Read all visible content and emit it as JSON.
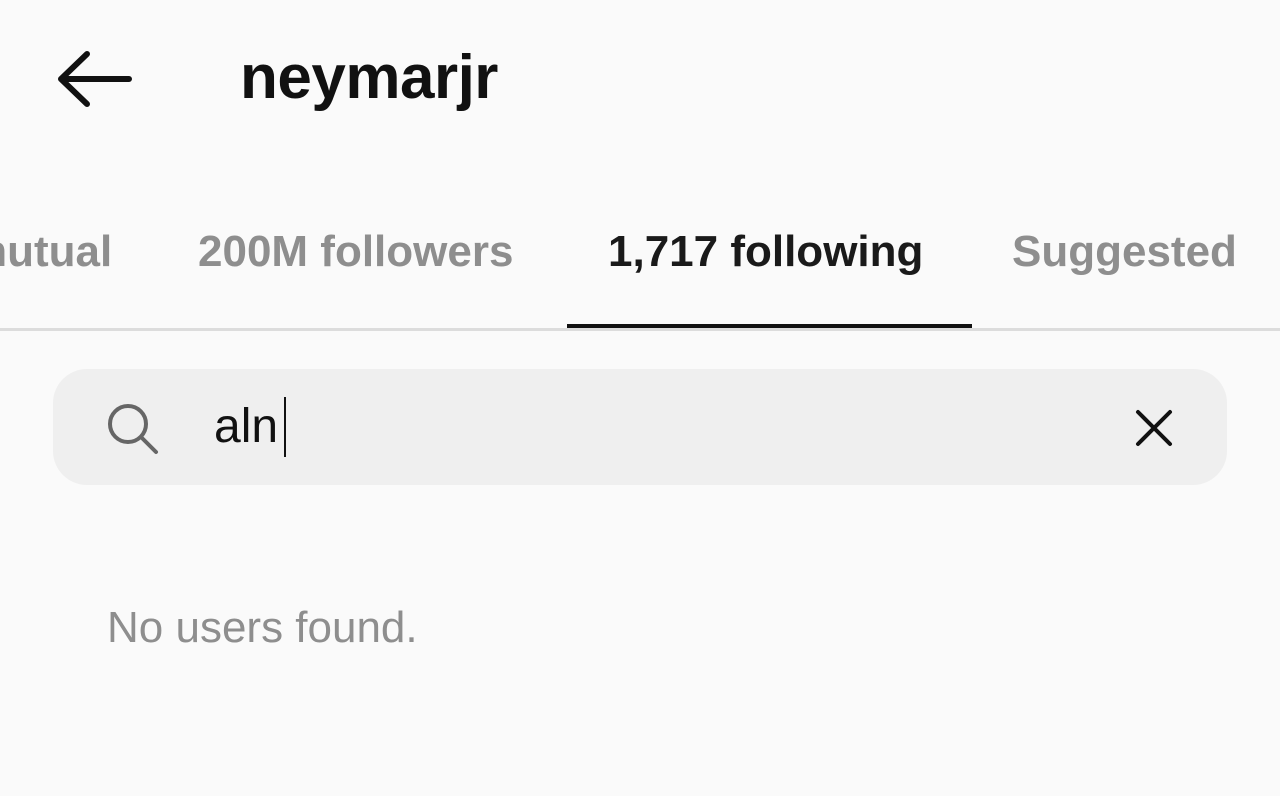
{
  "header": {
    "back_icon": "arrow-left-icon",
    "title": "neymarjr"
  },
  "tabs": [
    {
      "label": "mutual",
      "active": false
    },
    {
      "label": "200M followers",
      "active": false
    },
    {
      "label": "1,717 following",
      "active": true
    },
    {
      "label": "Suggested",
      "active": false
    }
  ],
  "search": {
    "icon": "search-icon",
    "value": "aln",
    "clear_icon": "close-icon"
  },
  "results": {
    "empty_message": "No users found."
  },
  "colors": {
    "background": "#fafafa",
    "search_background": "#efefef",
    "muted_text": "#8e8e8e",
    "primary_text": "#111111",
    "divider": "#dcdcdc"
  }
}
